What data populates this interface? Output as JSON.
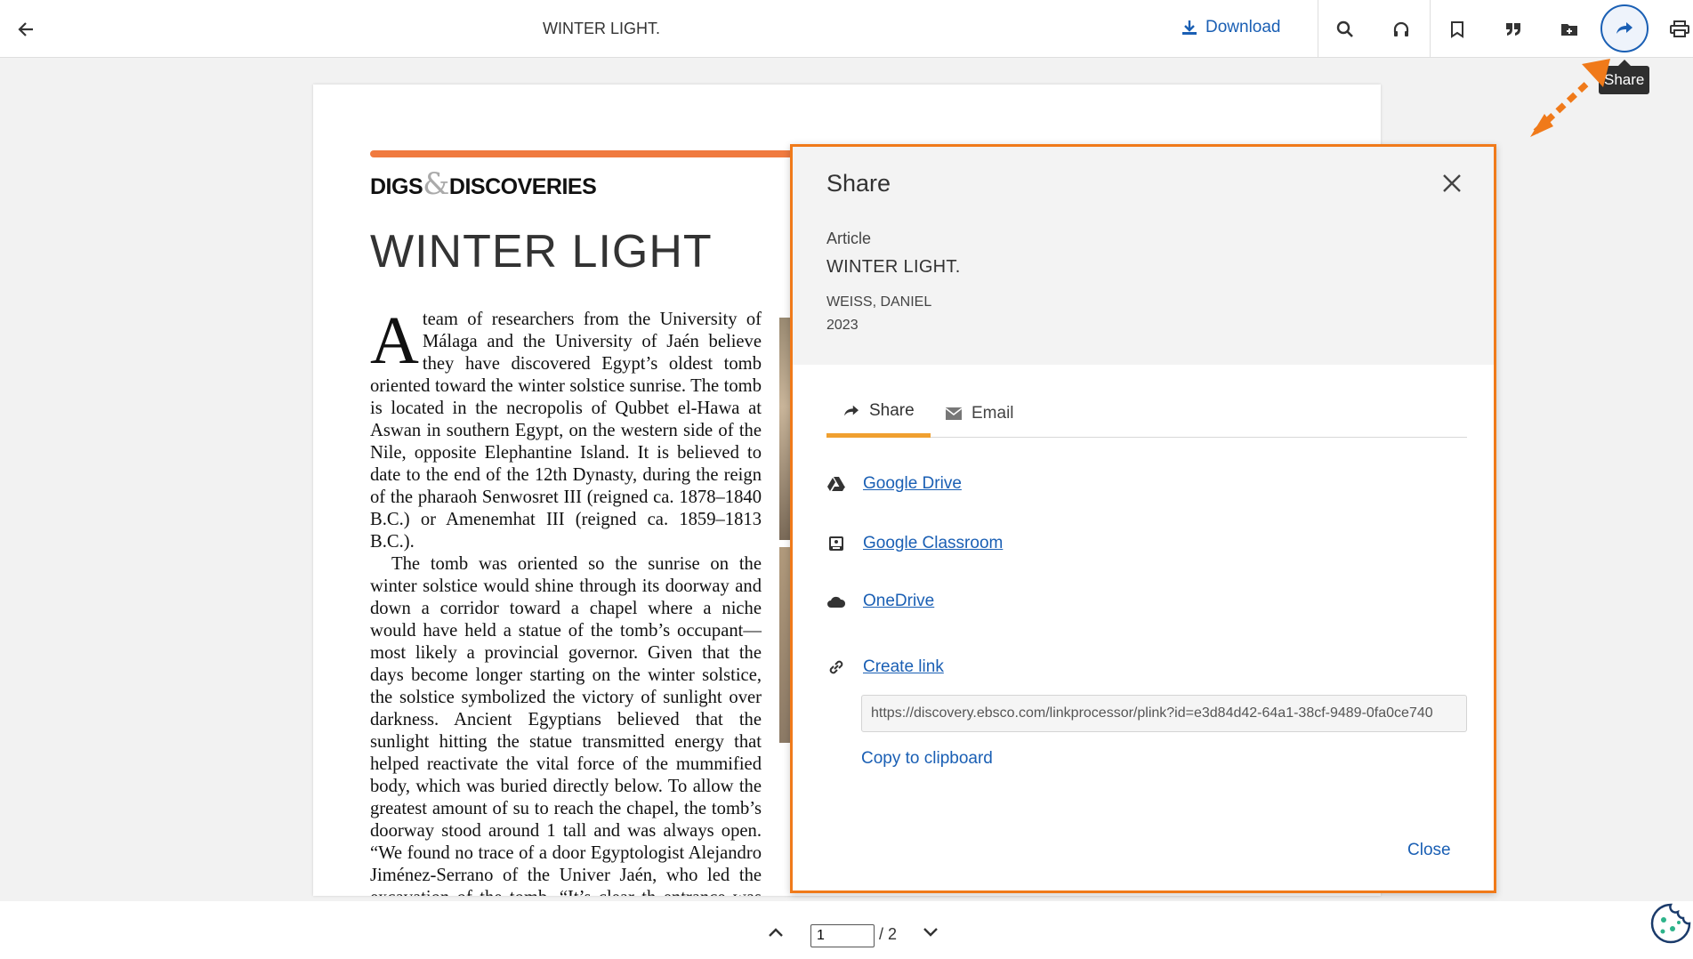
{
  "topbar": {
    "title": "WINTER LIGHT.",
    "download_label": "Download",
    "share_tooltip": "Share",
    "icons": [
      "back-arrow-icon",
      "download-icon",
      "search-icon",
      "headphones-icon",
      "bookmark-icon",
      "quote-icon",
      "add-folder-icon",
      "share-icon",
      "print-icon"
    ]
  },
  "document": {
    "section": "DIGS",
    "section_amp": "&",
    "section_tail": "DISCOVERIES",
    "title": "WINTER LIGHT",
    "dropcap": "A",
    "para1": "team of researchers from the University of Málaga and the University of Jaén believe they have discovered Egypt’s oldest tomb oriented toward the winter solstice sunrise. The tomb is located in the necropolis of Qubbet el-Hawa at Aswan in southern Egypt, on the western side of the Nile, opposite Elephantine Island. It is believed to date to the end of the 12th Dynasty, during the reign of the pharaoh Senwosret III (reigned ca. 1878–1840 B.C.) or Amenemhat III (reigned ca. 1859–1813 B.C.).",
    "para2": "The tomb was oriented so the sunrise on the winter solstice would shine through its doorway and down a corridor toward a chapel where a niche would have held a statue of the tomb’s occupant—most likely a provincial governor. Given that the days become longer starting on the winter solstice, the solstice symbolized the victory of sunlight over darkness. Ancient Egyptians believed that the sunlight hitting the statue transmitted energy that helped reactivate the vital force of the mummified body, which was buried directly below. To allow the greatest amount of su to reach the chapel, the tomb’s doorway stood around 1 tall and was always open. “We found no trace of a door Egyptologist Alejandro Jiménez-Serrano of the Univer Jaén, who led the excavation of the tomb. “It’s clear th entrance was made to receive the sun’s rays.”"
  },
  "dialog": {
    "title": "Share",
    "type": "Article",
    "article_title": "WINTER LIGHT.",
    "author": "WEISS, DANIEL",
    "year": "2023",
    "tabs": [
      {
        "label": "Share",
        "icon": "share-icon",
        "active": true
      },
      {
        "label": "Email",
        "icon": "envelope-icon",
        "active": false
      }
    ],
    "services": [
      {
        "label": "Google Drive",
        "icon": "google-drive-icon"
      },
      {
        "label": "Google Classroom",
        "icon": "google-classroom-icon"
      },
      {
        "label": "OneDrive",
        "icon": "cloud-icon"
      }
    ],
    "create_link_label": "Create link",
    "url": "https://discovery.ebsco.com/linkprocessor/plink?id=e3d84d42-64a1-38cf-9489-0fa0ce740",
    "copy_label": "Copy to clipboard",
    "close_label": "Close"
  },
  "pager": {
    "current": "1",
    "total": "/ 2"
  },
  "colors": {
    "accent": "#1a5fb4",
    "highlight": "#f07a1a",
    "tab_underline": "#f0a030",
    "section_rule": "#f07a3f"
  }
}
